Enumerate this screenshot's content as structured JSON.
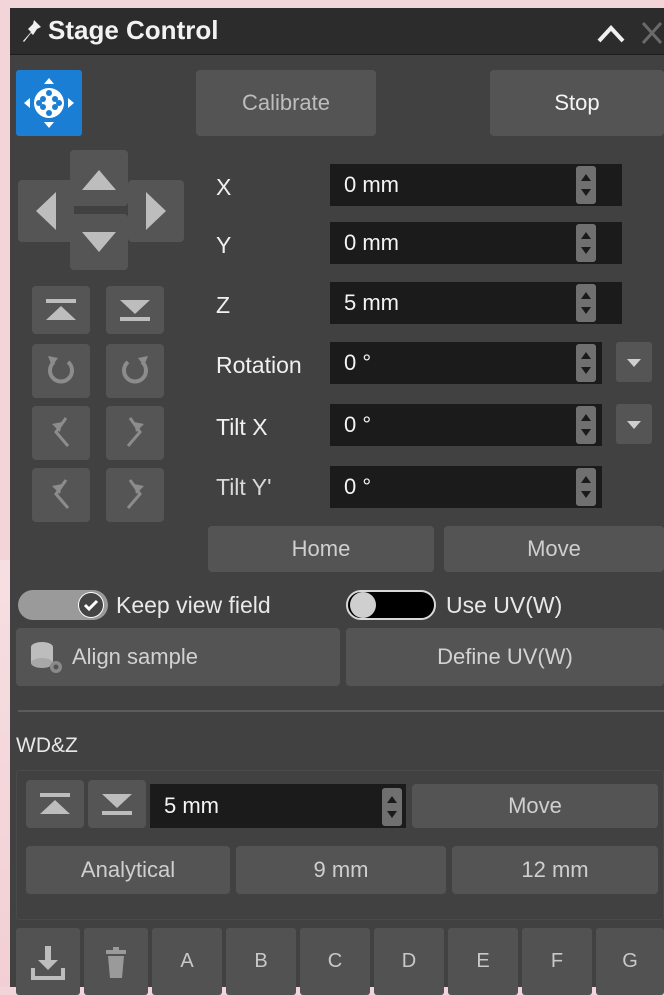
{
  "titlebar": {
    "title": "Stage Control"
  },
  "toolbar": {
    "calibrate_label": "Calibrate",
    "stop_label": "Stop"
  },
  "coordinates": [
    {
      "label": "X",
      "value": "0 mm"
    },
    {
      "label": "Y",
      "value": "0 mm"
    },
    {
      "label": "Z",
      "value": "5 mm"
    },
    {
      "label": "Rotation",
      "value": "0 °"
    },
    {
      "label": "Tilt X",
      "value": "0 °"
    },
    {
      "label": "Tilt Y'",
      "value": "0 °"
    }
  ],
  "actions": {
    "home_label": "Home",
    "move_label": "Move"
  },
  "toggles": {
    "keep_view_field": {
      "label": "Keep view field",
      "on": true
    },
    "use_uv": {
      "label": "Use UV(W)",
      "on": false
    }
  },
  "align": {
    "align_sample_label": "Align sample",
    "define_uv_label": "Define UV(W)"
  },
  "wdz": {
    "title": "WD&Z",
    "value": "5 mm",
    "move_label": "Move",
    "presets": [
      "Analytical",
      "9 mm",
      "12 mm"
    ]
  },
  "bookmarks": [
    "A",
    "B",
    "C",
    "D",
    "E",
    "F",
    "G"
  ],
  "colors": {
    "accent": "#1a7fd4",
    "panel": "#414141",
    "field": "#1b1b1b",
    "button": "#545454"
  }
}
